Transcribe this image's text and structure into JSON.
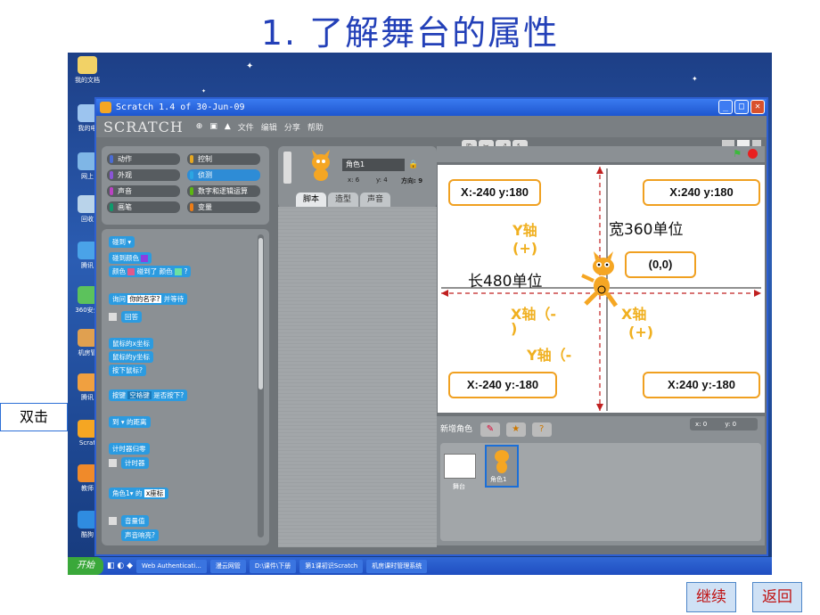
{
  "slide_title": "1. 了解舞台的属性",
  "window_title": "Scratch 1.4 of 30-Jun-09",
  "logo": "SCRATCH",
  "menu": [
    "文件",
    "编辑",
    "分享",
    "帮助"
  ],
  "categories": [
    {
      "label": "动作",
      "color": "#4a6cd4"
    },
    {
      "label": "控制",
      "color": "#e6a822"
    },
    {
      "label": "外观",
      "color": "#8a55d7"
    },
    {
      "label": "侦测",
      "color": "#2ca5e2"
    },
    {
      "label": "声音",
      "color": "#bb42c3"
    },
    {
      "label": "数字和逻辑运算",
      "color": "#5cb712"
    },
    {
      "label": "画笔",
      "color": "#0e9a6c"
    },
    {
      "label": "变量",
      "color": "#ee7d16"
    }
  ],
  "blocks": [
    "碰到",
    "碰到颜色",
    "颜色",
    "碰到了",
    "颜色",
    "?",
    "询问",
    "你的名字?",
    "并等待",
    "回答",
    "鼠标的x坐标",
    "鼠标的y坐标",
    "按下鼠标?",
    "按键",
    "空格键",
    "是否按下?",
    "到",
    "的距离",
    "计时器归零",
    "计时器",
    "角色1",
    "的",
    "x座标",
    "音量值",
    "声音响亮?"
  ],
  "sprite": {
    "name": "角色1",
    "x_label": "x: 6",
    "y_label": "y: 4",
    "dir_label": "方向: 9"
  },
  "tabs": [
    "脚本",
    "造型",
    "声音"
  ],
  "stage": {
    "callout_tl": "X:-240 y:180",
    "callout_tr": "X:240 y:180",
    "callout_center": "(0,0)",
    "callout_bl": "X:-240 y:-180",
    "callout_br": "X:240 y:-180",
    "y_plus_1": "Y轴",
    "y_plus_2": "(+)",
    "width_label": "宽360单位",
    "length_label": "长480单位",
    "x_minus_1": "X轴（-",
    "x_minus_2": ")",
    "x_plus_1": "X轴",
    "x_plus_2": "(+)",
    "y_minus": "Y轴（-"
  },
  "sprite_panel": {
    "title": "新增角色",
    "coords_x": "x: 0",
    "coords_y": "y: 0",
    "stage_label": "舞台",
    "sprite_label": "角色1"
  },
  "taskbar": [
    "开始",
    "Web Authenticati...",
    "漫云网管",
    "D:\\课件\\下册",
    "第1课初识Scratch",
    "机房课时管理系统"
  ],
  "double_click": "双击",
  "continue_btn": "继续",
  "back_btn": "返回",
  "desktop_icons": [
    "我的文档",
    "我的电",
    "网上",
    "回收",
    "腾讯",
    "360安全",
    "机房管",
    "腾讯",
    "Scrat",
    "教师",
    "酷狗"
  ]
}
